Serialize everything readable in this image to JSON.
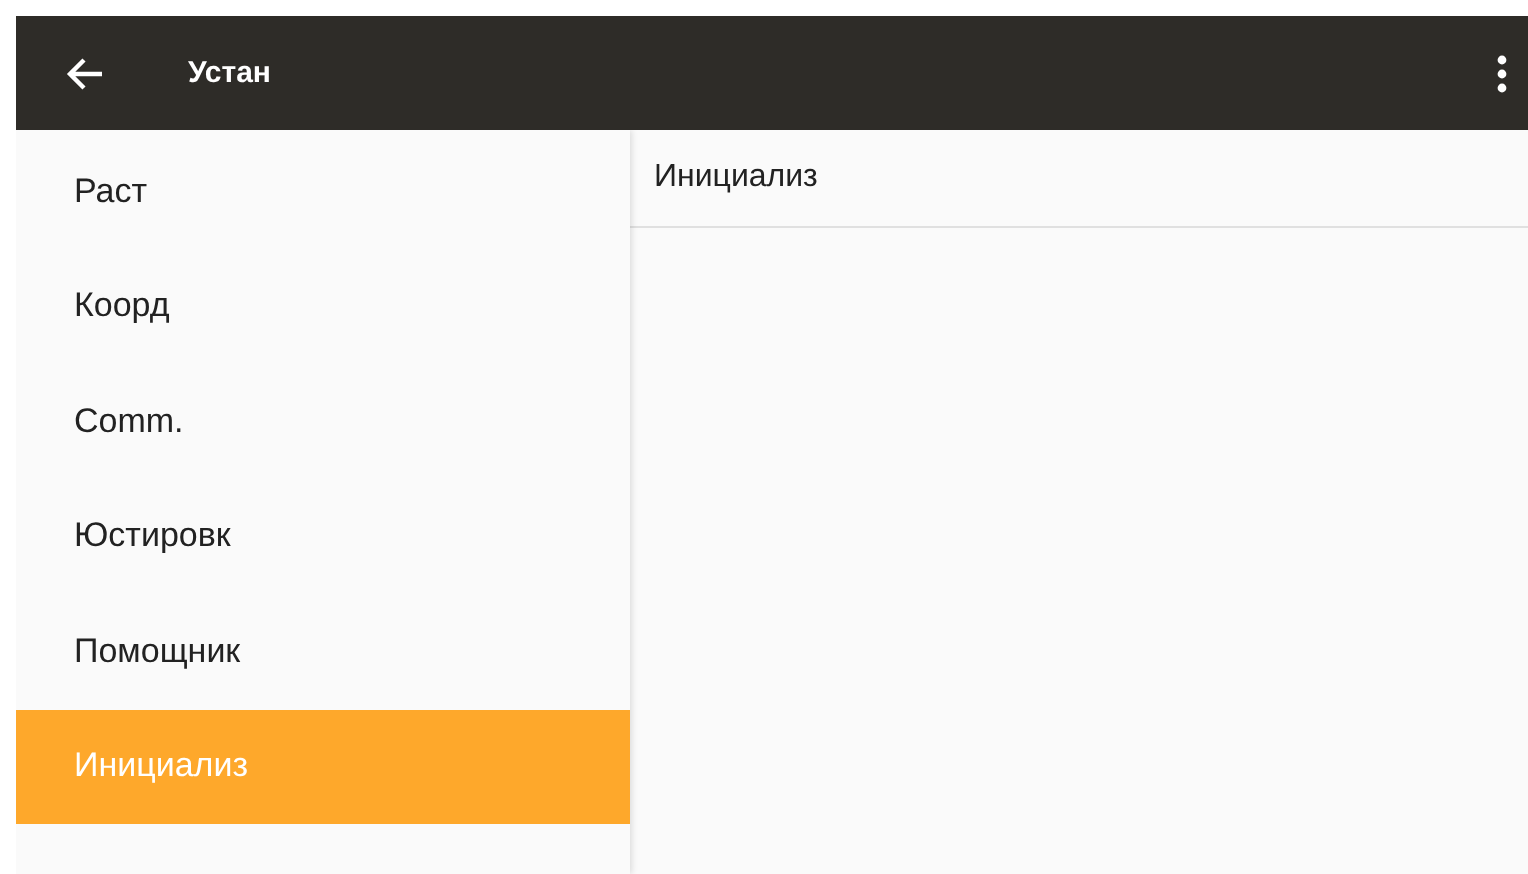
{
  "app_bar": {
    "title": "Устан"
  },
  "sidebar": {
    "items": [
      {
        "label": "Раст",
        "selected": false
      },
      {
        "label": "Коорд",
        "selected": false
      },
      {
        "label": "Comm.",
        "selected": false
      },
      {
        "label": "Юстировк",
        "selected": false
      },
      {
        "label": "Помощник",
        "selected": false
      },
      {
        "label": "Инициализ",
        "selected": true
      }
    ]
  },
  "detail": {
    "header": "Инициализ"
  }
}
